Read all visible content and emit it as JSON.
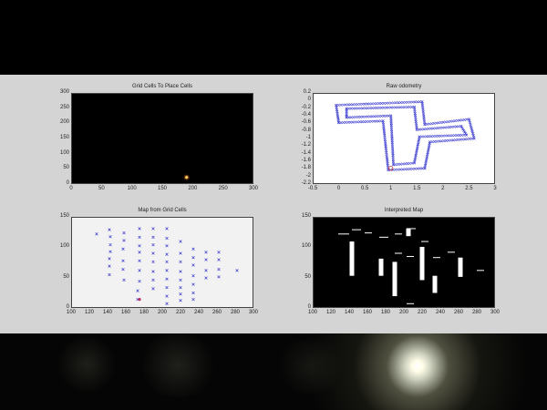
{
  "subplots": {
    "grid_cells": {
      "title": "Grid Cells To Place Cells",
      "x_ticks": [
        "0",
        "50",
        "100",
        "150",
        "200",
        "250",
        "300"
      ],
      "y_ticks": [
        "300",
        "250",
        "200",
        "150",
        "100",
        "50",
        "0"
      ],
      "background": "#000000"
    },
    "odometry": {
      "title": "Raw odometry",
      "x_ticks": [
        "-0.5",
        "0",
        "0.5",
        "1",
        "1.5",
        "2",
        "2.5",
        "3"
      ],
      "y_ticks": [
        "0.2",
        "0",
        "-0.2",
        "-0.4",
        "-0.6",
        "-0.8",
        "-1",
        "-1.2",
        "-1.4",
        "-1.6",
        "-1.8",
        "-2",
        "-2.2"
      ],
      "background": "#ffffff",
      "marker_color": "#3a3ad0"
    },
    "grid_map": {
      "title": "Map from Grid Cells",
      "x_ticks": [
        "100",
        "120",
        "140",
        "160",
        "180",
        "200",
        "220",
        "240",
        "260",
        "280",
        "300"
      ],
      "y_ticks": [
        "150",
        "100",
        "50",
        "0"
      ],
      "background": "#f2f2f2",
      "marker_color": "#3a3ad0"
    },
    "interpreted_map": {
      "title": "Interpreted Map",
      "x_ticks": [
        "100",
        "120",
        "140",
        "160",
        "180",
        "200",
        "220",
        "240",
        "260",
        "280",
        "300"
      ],
      "y_ticks": [
        "150",
        "100",
        "50",
        "0"
      ],
      "background": "#000000"
    }
  },
  "chart_data": [
    {
      "type": "heatmap",
      "title": "Grid Cells To Place Cells",
      "xlim": [
        0,
        300
      ],
      "ylim": [
        0,
        300
      ],
      "hotspot": {
        "x": 190,
        "y": 22
      }
    },
    {
      "type": "scatter",
      "title": "Raw odometry",
      "xlim": [
        -0.5,
        3
      ],
      "ylim": [
        -2.3,
        0.3
      ]
    },
    {
      "type": "scatter",
      "title": "Map from Grid Cells",
      "xlim": [
        100,
        300
      ],
      "ylim": [
        0,
        170
      ],
      "points": [
        [
          128,
          138
        ],
        [
          142,
          146
        ],
        [
          143,
          133
        ],
        [
          143,
          118
        ],
        [
          143,
          105
        ],
        [
          142,
          92
        ],
        [
          142,
          78
        ],
        [
          142,
          62
        ],
        [
          158,
          140
        ],
        [
          158,
          126
        ],
        [
          157,
          110
        ],
        [
          157,
          88
        ],
        [
          157,
          72
        ],
        [
          158,
          52
        ],
        [
          175,
          148
        ],
        [
          175,
          132
        ],
        [
          175,
          116
        ],
        [
          175,
          104
        ],
        [
          175,
          88
        ],
        [
          175,
          70
        ],
        [
          175,
          50
        ],
        [
          173,
          32
        ],
        [
          173,
          16
        ],
        [
          190,
          148
        ],
        [
          190,
          132
        ],
        [
          190,
          118
        ],
        [
          190,
          102
        ],
        [
          190,
          86
        ],
        [
          190,
          68
        ],
        [
          190,
          52
        ],
        [
          190,
          36
        ],
        [
          205,
          148
        ],
        [
          205,
          130
        ],
        [
          205,
          116
        ],
        [
          205,
          100
        ],
        [
          205,
          86
        ],
        [
          205,
          70
        ],
        [
          205,
          54
        ],
        [
          205,
          38
        ],
        [
          205,
          22
        ],
        [
          205,
          8
        ],
        [
          220,
          124
        ],
        [
          220,
          102
        ],
        [
          220,
          86
        ],
        [
          220,
          68
        ],
        [
          220,
          52
        ],
        [
          220,
          38
        ],
        [
          220,
          26
        ],
        [
          220,
          14
        ],
        [
          234,
          110
        ],
        [
          234,
          94
        ],
        [
          234,
          80
        ],
        [
          234,
          60
        ],
        [
          234,
          44
        ],
        [
          234,
          28
        ],
        [
          234,
          16
        ],
        [
          248,
          104
        ],
        [
          248,
          90
        ],
        [
          248,
          70
        ],
        [
          248,
          56
        ],
        [
          262,
          104
        ],
        [
          262,
          90
        ],
        [
          262,
          72
        ],
        [
          262,
          58
        ],
        [
          282,
          70
        ]
      ]
    },
    {
      "type": "bar",
      "title": "Interpreted Map",
      "xlim": [
        100,
        300
      ],
      "ylim": [
        0,
        170
      ],
      "segments": [
        {
          "x1": 128,
          "x2": 140,
          "y1": 138,
          "y2": 138
        },
        {
          "x1": 143,
          "x2": 153,
          "y1": 146,
          "y2": 146
        },
        {
          "x1": 157,
          "x2": 165,
          "y1": 140,
          "y2": 140
        },
        {
          "x1": 173,
          "x2": 183,
          "y1": 132,
          "y2": 132
        },
        {
          "x1": 190,
          "x2": 198,
          "y1": 138,
          "y2": 138
        },
        {
          "x1": 203,
          "x2": 213,
          "y1": 148,
          "y2": 148
        },
        {
          "x1": 219,
          "x2": 227,
          "y1": 124,
          "y2": 124
        },
        {
          "x1": 190,
          "x2": 198,
          "y1": 102,
          "y2": 102
        },
        {
          "x1": 203,
          "x2": 211,
          "y1": 96,
          "y2": 96
        },
        {
          "x1": 232,
          "x2": 240,
          "y1": 94,
          "y2": 94
        },
        {
          "x1": 248,
          "x2": 256,
          "y1": 104,
          "y2": 104
        },
        {
          "x1": 280,
          "x2": 288,
          "y1": 70,
          "y2": 70
        },
        {
          "x1": 203,
          "x2": 211,
          "y1": 8,
          "y2": 8
        }
      ],
      "bars": [
        {
          "x": 143,
          "y0": 60,
          "y1": 124
        },
        {
          "x": 175,
          "y0": 60,
          "y1": 92
        },
        {
          "x": 190,
          "y0": 22,
          "y1": 86
        },
        {
          "x": 205,
          "y0": 134,
          "y1": 148
        },
        {
          "x": 220,
          "y0": 52,
          "y1": 114
        },
        {
          "x": 234,
          "y0": 28,
          "y1": 60
        },
        {
          "x": 262,
          "y0": 58,
          "y1": 94
        }
      ]
    }
  ]
}
